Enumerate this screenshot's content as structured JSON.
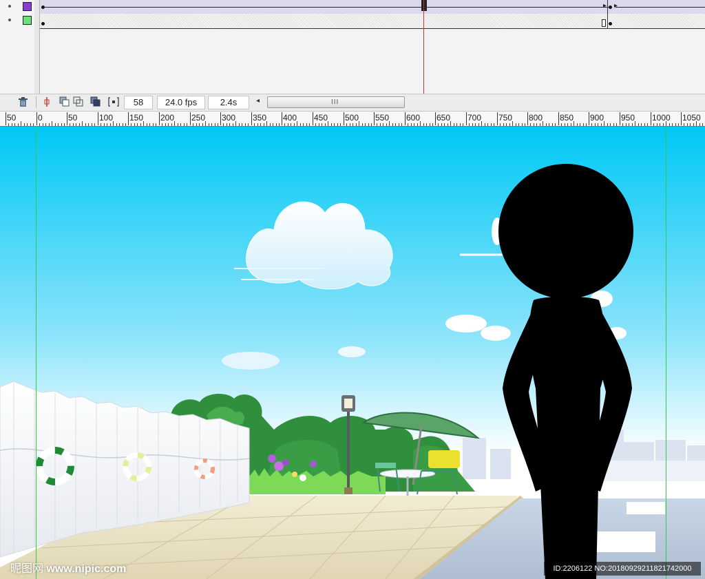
{
  "timeline": {
    "layers": [
      {
        "swatch_color": "#8a3fd1"
      },
      {
        "swatch_color": "#6de07a"
      }
    ]
  },
  "toolbar": {
    "frame_number": "58",
    "frame_rate": "24.0 fps",
    "elapsed_time": "2.4s",
    "scrollbar_grip": "III"
  },
  "ruler": {
    "labels": [
      "50",
      "0",
      "50",
      "100",
      "150",
      "200",
      "250",
      "300",
      "350",
      "400",
      "450",
      "500",
      "550",
      "600",
      "650",
      "700",
      "750",
      "800",
      "850",
      "900",
      "950",
      "1000",
      "1050"
    ]
  },
  "stage": {
    "watermark_left": {
      "brand": "昵图网",
      "url": "www.nipic.com"
    },
    "watermark_right": "ID:2206122 NO:20180929211821742000"
  },
  "colors": {
    "sky_top": "#00c8f5",
    "sky_bottom": "#ffffff",
    "playhead": "#c0392b",
    "guide": "#35c94a",
    "silhouette": "#000000"
  }
}
